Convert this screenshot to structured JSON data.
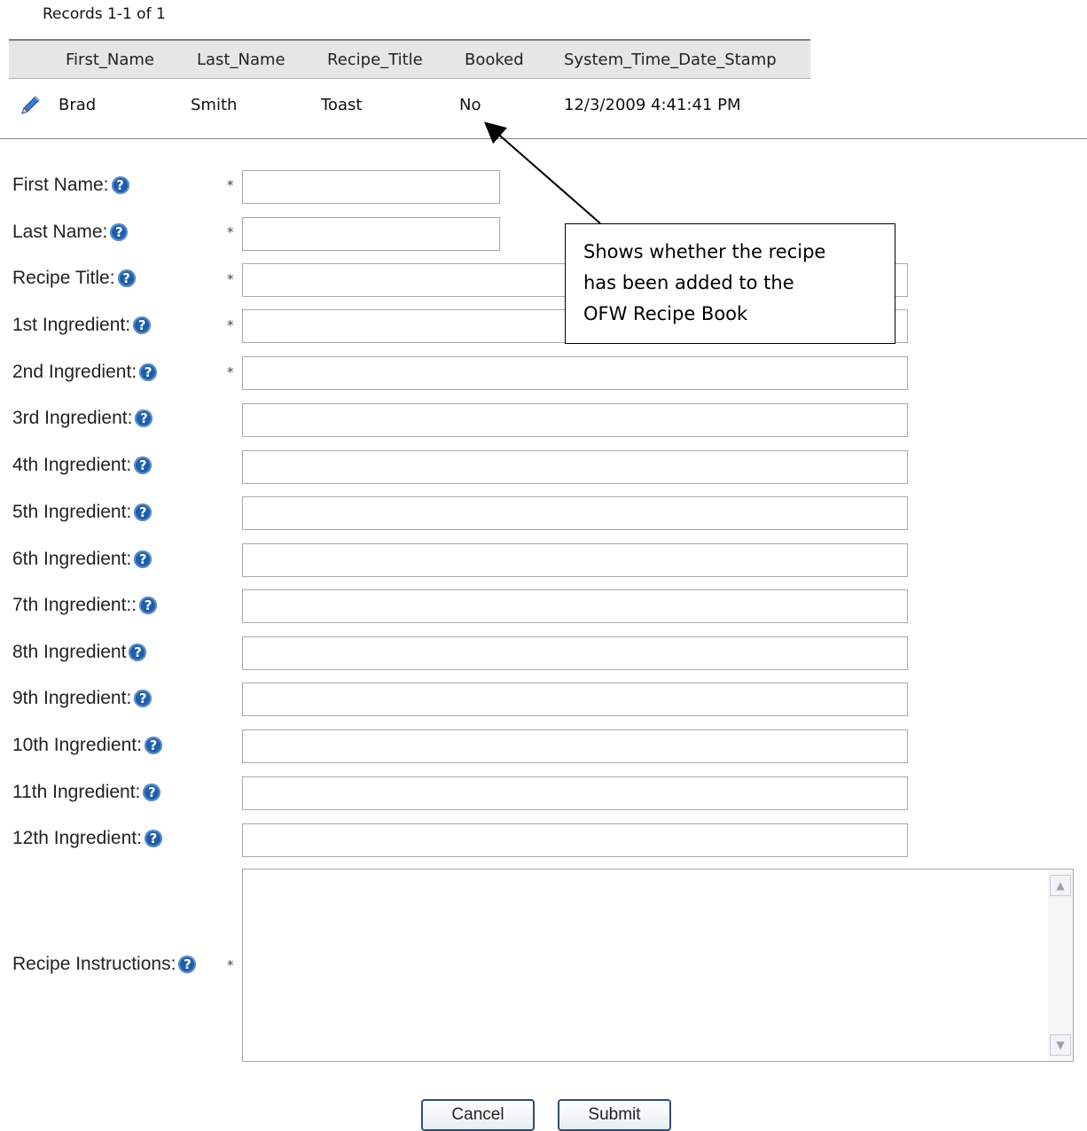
{
  "records_label": "Records 1-1 of 1",
  "grid": {
    "columns": [
      "First_Name",
      "Last_Name",
      "Recipe_Title",
      "Booked",
      "System_Time_Date_Stamp"
    ],
    "rows": [
      {
        "first_name": "Brad",
        "last_name": "Smith",
        "recipe_title": "Toast",
        "booked": "No",
        "timestamp": "12/3/2009 4:41:41 PM"
      }
    ]
  },
  "form": {
    "labels": {
      "first_name": "First Name:",
      "last_name": "Last Name:",
      "recipe_title": "Recipe Title:",
      "ing1": "1st Ingredient:",
      "ing2": "2nd Ingredient:",
      "ing3": "3rd Ingredient:",
      "ing4": "4th Ingredient:",
      "ing5": "5th Ingredient:",
      "ing6": "6th Ingredient:",
      "ing7": "7th Ingredient::",
      "ing8": "8th Ingredient",
      "ing9": "9th Ingredient:",
      "ing10": "10th Ingredient:",
      "ing11": "11th Ingredient:",
      "ing12": "12th Ingredient:",
      "instructions": "Recipe Instructions:"
    },
    "required_mark": "*",
    "values": {
      "first_name": "",
      "last_name": "",
      "recipe_title": "",
      "ing1": "",
      "ing2": "",
      "ing3": "",
      "ing4": "",
      "ing5": "",
      "ing6": "",
      "ing7": "",
      "ing8": "",
      "ing9": "",
      "ing10": "",
      "ing11": "",
      "ing12": "",
      "instructions": ""
    }
  },
  "buttons": {
    "cancel": "Cancel",
    "submit": "Submit"
  },
  "callout": {
    "line1": "Shows whether the recipe",
    "line2": "has been added to the",
    "line3": "OFW Recipe Book"
  },
  "help_glyph": "?",
  "icons": {
    "edit": "pencil-icon",
    "help": "question-circle-icon"
  },
  "colors": {
    "help_icon": "#1f5ea8",
    "grid_header": "#e6e6e6",
    "button_border": "#2f4d7a"
  }
}
